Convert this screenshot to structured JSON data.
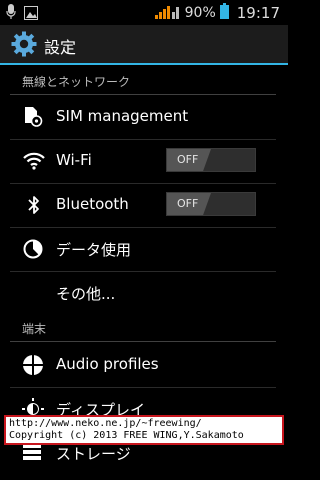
{
  "status_bar": {
    "battery_percent": "90%",
    "time": "19:17",
    "icons": [
      "microphone-icon",
      "image-icon",
      "signal-bars-icon",
      "battery-icon"
    ]
  },
  "action_bar": {
    "title": "設定",
    "icon": "settings-gear-icon"
  },
  "sections": [
    {
      "header": "無線とネットワーク",
      "items": [
        {
          "label": "SIM management",
          "icon": "sim-card-icon"
        },
        {
          "label": "Wi-Fi",
          "icon": "wifi-icon",
          "toggle": "OFF"
        },
        {
          "label": "Bluetooth",
          "icon": "bluetooth-icon",
          "toggle": "OFF"
        },
        {
          "label": "データ使用",
          "icon": "data-usage-icon"
        },
        {
          "label": "その他..."
        }
      ]
    },
    {
      "header": "端末",
      "items": [
        {
          "label": "Audio profiles",
          "icon": "audio-profiles-icon"
        },
        {
          "label": "ディスプレイ",
          "icon": "display-brightness-icon"
        },
        {
          "label": "ストレージ",
          "icon": "storage-icon"
        }
      ]
    }
  ],
  "watermark": {
    "line1": "http://www.neko.ne.jp/~freewing/",
    "line2": "Copyright (c) 2013 FREE WING,Y.Sakamoto"
  },
  "colors": {
    "accent": "#33b5e5",
    "signal": "#f08a00",
    "background": "#000000",
    "watermark_border": "#c8161e"
  }
}
